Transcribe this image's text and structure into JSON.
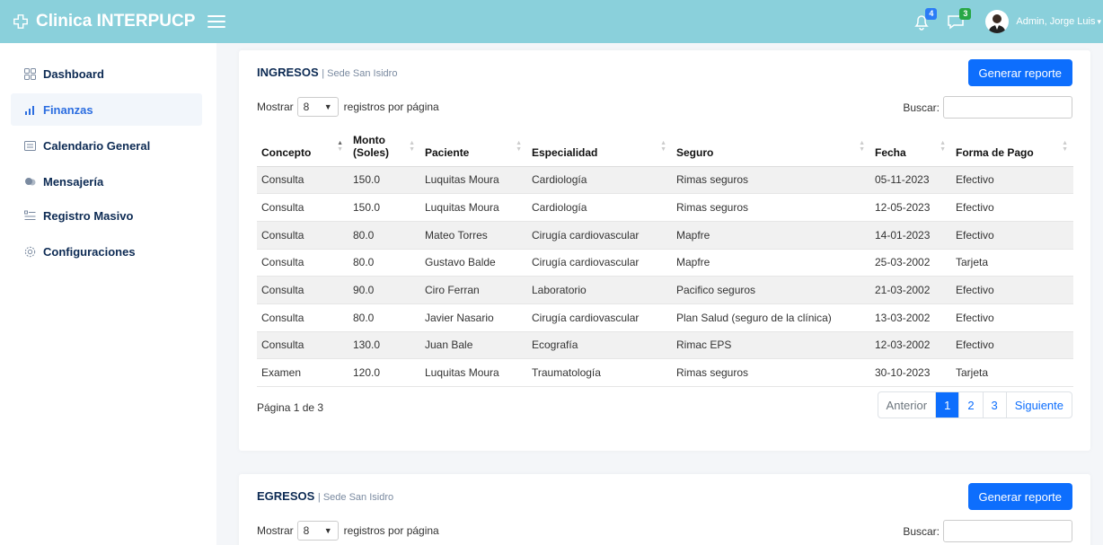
{
  "header": {
    "brand": "Clinica INTERPUCP",
    "notifications_count": "4",
    "messages_count": "3",
    "user": "Admin, Jorge Luis",
    "bg_color": "#8ad0db"
  },
  "sidebar": {
    "items": [
      {
        "label": "Dashboard",
        "icon": "grid-icon"
      },
      {
        "label": "Finanzas",
        "icon": "chart-bars-icon",
        "active": true
      },
      {
        "label": "Calendario General",
        "icon": "calendar-icon"
      },
      {
        "label": "Mensajería",
        "icon": "chat-icon"
      },
      {
        "label": "Registro Masivo",
        "icon": "list-icon"
      },
      {
        "label": "Configuraciones",
        "icon": "gear-icon"
      }
    ]
  },
  "ingresos": {
    "title": "INGRESOS",
    "subtitle": "| Sede San Isidro",
    "report_button": "Generar reporte",
    "show_prefix": "Mostrar",
    "page_size": "8",
    "show_suffix": "registros por página",
    "search_label": "Buscar:",
    "columns": [
      "Concepto",
      "Monto (Soles)",
      "Paciente",
      "Especialidad",
      "Seguro",
      "Fecha",
      "Forma de Pago"
    ],
    "rows": [
      [
        "Consulta",
        "150.0",
        "Luquitas Moura",
        "Cardiología",
        "Rimas seguros",
        "05-11-2023",
        "Efectivo"
      ],
      [
        "Consulta",
        "150.0",
        "Luquitas Moura",
        "Cardiología",
        "Rimas seguros",
        "12-05-2023",
        "Efectivo"
      ],
      [
        "Consulta",
        "80.0",
        "Mateo Torres",
        "Cirugía cardiovascular",
        "Mapfre",
        "14-01-2023",
        "Efectivo"
      ],
      [
        "Consulta",
        "80.0",
        "Gustavo Balde",
        "Cirugía cardiovascular",
        "Mapfre",
        "25-03-2002",
        "Tarjeta"
      ],
      [
        "Consulta",
        "90.0",
        "Ciro Ferran",
        "Laboratorio",
        "Pacifico seguros",
        "21-03-2002",
        "Efectivo"
      ],
      [
        "Consulta",
        "80.0",
        "Javier Nasario",
        "Cirugía cardiovascular",
        "Plan Salud (seguro de la clínica)",
        "13-03-2002",
        "Efectivo"
      ],
      [
        "Consulta",
        "130.0",
        "Juan Bale",
        "Ecografía",
        "Rimac EPS",
        "12-03-2002",
        "Efectivo"
      ],
      [
        "Examen",
        "120.0",
        "Luquitas Moura",
        "Traumatología",
        "Rimas seguros",
        "30-10-2023",
        "Tarjeta"
      ]
    ],
    "page_info": "Página 1 de 3",
    "pagination": {
      "prev": "Anterior",
      "pages": [
        "1",
        "2",
        "3"
      ],
      "current": "1",
      "next": "Siguiente"
    }
  },
  "egresos": {
    "title": "EGRESOS",
    "subtitle": "| Sede San Isidro",
    "report_button": "Generar reporte",
    "show_prefix": "Mostrar",
    "page_size": "8",
    "show_suffix": "registros por página",
    "search_label": "Buscar:"
  }
}
